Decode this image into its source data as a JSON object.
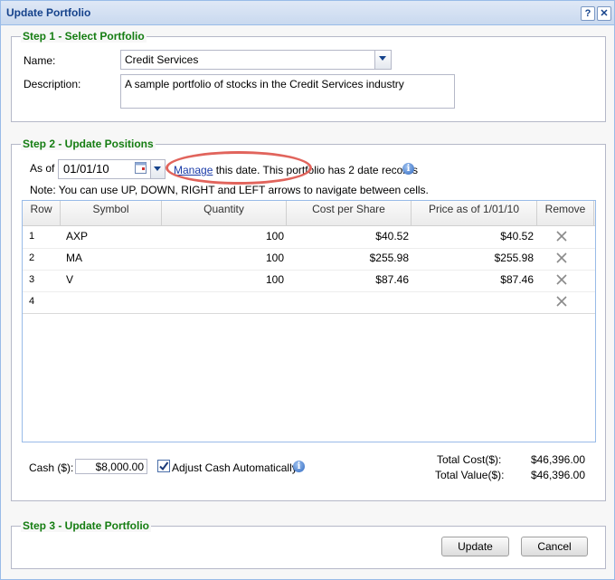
{
  "window": {
    "title": "Update Portfolio",
    "help_label": "?",
    "close_label": "✕"
  },
  "step1": {
    "legend": "Step 1 - Select Portfolio",
    "name_label": "Name:",
    "name_value": "Credit Services",
    "description_label": "Description:",
    "description_value": "A sample portfolio of stocks in the Credit Services industry"
  },
  "step2": {
    "legend": "Step 2 - Update Positions",
    "as_of_label": "As of",
    "date_value": "01/01/10",
    "manage_link": "Manage",
    "manage_suffix": "this date. This portfolio has 2 date records",
    "note": "Note: You can use UP, DOWN, RIGHT and LEFT arrows to navigate between cells.",
    "columns": [
      "Row",
      "Symbol",
      "Quantity",
      "Cost per Share",
      "Price as of 1/01/10",
      "Remove"
    ],
    "rows": [
      {
        "row": "1",
        "symbol": "AXP",
        "quantity": "100",
        "cost": "$40.52",
        "price": "$40.52"
      },
      {
        "row": "2",
        "symbol": "MA",
        "quantity": "100",
        "cost": "$255.98",
        "price": "$255.98"
      },
      {
        "row": "3",
        "symbol": "V",
        "quantity": "100",
        "cost": "$87.46",
        "price": "$87.46"
      },
      {
        "row": "4",
        "symbol": "",
        "quantity": "",
        "cost": "",
        "price": ""
      }
    ],
    "cash_label": "Cash ($):",
    "cash_value": "$8,000.00",
    "adjust_cash_label": "Adjust Cash Automatically",
    "adjust_cash_checked": true,
    "total_cost_label": "Total Cost($):",
    "total_cost_value": "$46,396.00",
    "total_value_label": "Total Value($):",
    "total_value_value": "$46,396.00"
  },
  "step3": {
    "legend": "Step 3 - Update Portfolio",
    "update_label": "Update",
    "cancel_label": "Cancel"
  },
  "colors": {
    "legend": "#157d12",
    "title": "#15428b",
    "annotation": "#e1645c",
    "link": "#1a3ba8"
  }
}
